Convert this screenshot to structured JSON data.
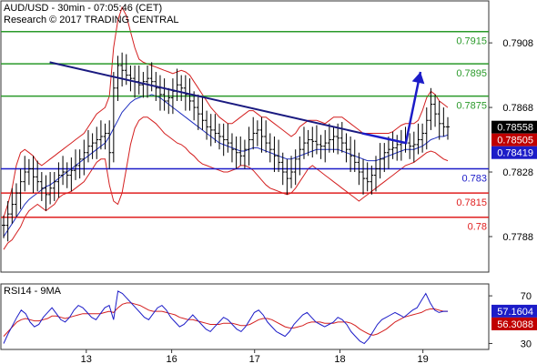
{
  "header": {
    "line1": "AUD/USD - 30min - 07:05:46 (CET)",
    "line2": "Research © 2017 TRADING CENTRAL"
  },
  "chart_data": [
    {
      "type": "candlestick",
      "title": "AUD/USD - 30min - 07:05:46 (CET)",
      "y_ticks": [
        0.7908,
        0.7868,
        0.7828,
        0.7788
      ],
      "ylim": [
        0.7766,
        0.7934
      ],
      "x_ticks": [
        "13",
        "16",
        "17",
        "18",
        "19"
      ],
      "last_price": 0.78558,
      "price_tags": [
        {
          "value": 0.78558,
          "label": "0.78558",
          "color": "#000000"
        },
        {
          "value": 0.78505,
          "label": "0.78505",
          "color": "#c00000"
        },
        {
          "value": 0.78419,
          "label": "0.78419",
          "color": "#1c1cc8"
        }
      ],
      "levels": [
        {
          "value": 0.7915,
          "label": "0.7915",
          "color": "#2a9a2a"
        },
        {
          "value": 0.7895,
          "label": "0.7895",
          "color": "#2a9a2a"
        },
        {
          "value": 0.7875,
          "label": "0.7875",
          "color": "#2a9a2a"
        },
        {
          "value": 0.783,
          "label": "0.783",
          "color": "#1c1cc8"
        },
        {
          "value": 0.7815,
          "label": "0.7815",
          "color": "#e02020"
        },
        {
          "value": 0.78,
          "label": "0.78",
          "color": "#e02020"
        }
      ],
      "price_series": [
        0.7795,
        0.7802,
        0.7808,
        0.7815,
        0.7822,
        0.7828,
        0.783,
        0.7825,
        0.7822,
        0.7818,
        0.7814,
        0.7818,
        0.7822,
        0.7826,
        0.7828,
        0.7826,
        0.7829,
        0.7832,
        0.7836,
        0.784,
        0.7844,
        0.7846,
        0.7848,
        0.785,
        0.7852,
        0.784,
        0.788,
        0.7894,
        0.7891,
        0.7888,
        0.7886,
        0.7884,
        0.7882,
        0.7884,
        0.7886,
        0.7884,
        0.788,
        0.7876,
        0.7872,
        0.7874,
        0.7878,
        0.7882,
        0.788,
        0.7876,
        0.7872,
        0.7868,
        0.7864,
        0.786,
        0.7856,
        0.7854,
        0.7852,
        0.785,
        0.7848,
        0.7846,
        0.7842,
        0.784,
        0.7838,
        0.7842,
        0.7848,
        0.7852,
        0.7854,
        0.785,
        0.7846,
        0.7842,
        0.7838,
        0.7834,
        0.7828,
        0.7824,
        0.7828,
        0.7836,
        0.7842,
        0.7846,
        0.7848,
        0.7847,
        0.7845,
        0.7844,
        0.7846,
        0.7848,
        0.785,
        0.7849,
        0.7846,
        0.7842,
        0.7838,
        0.7834,
        0.7828,
        0.7824,
        0.7822,
        0.7826,
        0.783,
        0.7836,
        0.784,
        0.7842,
        0.7843,
        0.7845,
        0.7846,
        0.7846,
        0.7844,
        0.7845,
        0.7848,
        0.7852,
        0.786,
        0.787,
        0.7864,
        0.7858,
        0.7856,
        0.7856
      ],
      "ma_series": [
        0.7788,
        0.7792,
        0.7796,
        0.78,
        0.7804,
        0.7808,
        0.7811,
        0.7813,
        0.7815,
        0.7817,
        0.7819,
        0.782,
        0.7822,
        0.7824,
        0.7826,
        0.7828,
        0.783,
        0.7832,
        0.7834,
        0.7836,
        0.7838,
        0.784,
        0.7842,
        0.7844,
        0.7846,
        0.785,
        0.7855,
        0.786,
        0.7865,
        0.7868,
        0.7871,
        0.7873,
        0.7874,
        0.7875,
        0.7875,
        0.7876,
        0.7875,
        0.7874,
        0.7872,
        0.787,
        0.7868,
        0.7866,
        0.7864,
        0.7862,
        0.786,
        0.7858,
        0.7856,
        0.7854,
        0.7852,
        0.785,
        0.7848,
        0.7846,
        0.7845,
        0.7844,
        0.7843,
        0.7842,
        0.7841,
        0.7841,
        0.7842,
        0.7843,
        0.7843,
        0.7842,
        0.7841,
        0.784,
        0.7839,
        0.7838,
        0.7837,
        0.7836,
        0.7836,
        0.7837,
        0.7838,
        0.7839,
        0.784,
        0.7841,
        0.7842,
        0.7842,
        0.7842,
        0.7842,
        0.7842,
        0.7842,
        0.7841,
        0.784,
        0.7839,
        0.7838,
        0.7837,
        0.7836,
        0.7835,
        0.7835,
        0.7835,
        0.7836,
        0.7837,
        0.7838,
        0.7839,
        0.784,
        0.7841,
        0.7842,
        0.7842,
        0.7842,
        0.7843,
        0.7844,
        0.7846,
        0.7848,
        0.7849,
        0.785,
        0.785,
        0.7851
      ],
      "upper_band": [
        0.78,
        0.7808,
        0.7818,
        0.7832,
        0.784,
        0.7842,
        0.784,
        0.7838,
        0.7834,
        0.7832,
        0.7834,
        0.7836,
        0.7838,
        0.784,
        0.7842,
        0.7844,
        0.7846,
        0.7848,
        0.785,
        0.7852,
        0.7856,
        0.786,
        0.7864,
        0.7866,
        0.7868,
        0.7875,
        0.7905,
        0.7922,
        0.793,
        0.7925,
        0.7915,
        0.7905,
        0.7898,
        0.7896,
        0.7895,
        0.7894,
        0.7893,
        0.7892,
        0.7891,
        0.789,
        0.7889,
        0.789,
        0.7891,
        0.789,
        0.7888,
        0.7884,
        0.788,
        0.7876,
        0.7872,
        0.7868,
        0.7865,
        0.7862,
        0.786,
        0.7858,
        0.7858,
        0.786,
        0.7862,
        0.7864,
        0.7866,
        0.7866,
        0.7864,
        0.7862,
        0.7862,
        0.786,
        0.7858,
        0.7856,
        0.7854,
        0.7852,
        0.785,
        0.7852,
        0.7856,
        0.7858,
        0.786,
        0.786,
        0.786,
        0.7859,
        0.7858,
        0.786,
        0.7862,
        0.7862,
        0.7862,
        0.786,
        0.7858,
        0.7856,
        0.7854,
        0.7852,
        0.7852,
        0.7852,
        0.7852,
        0.7852,
        0.7852,
        0.7852,
        0.7853,
        0.7855,
        0.7857,
        0.7858,
        0.7858,
        0.7858,
        0.786,
        0.7866,
        0.7874,
        0.7878,
        0.7876,
        0.7872,
        0.787,
        0.7868
      ],
      "lower_band": [
        0.778,
        0.7784,
        0.7786,
        0.779,
        0.7794,
        0.78,
        0.7804,
        0.7806,
        0.7808,
        0.7806,
        0.7804,
        0.7806,
        0.7808,
        0.7812,
        0.7814,
        0.7815,
        0.7816,
        0.7818,
        0.782,
        0.7822,
        0.7826,
        0.783,
        0.7834,
        0.7836,
        0.7836,
        0.782,
        0.781,
        0.7808,
        0.7815,
        0.783,
        0.7845,
        0.7855,
        0.786,
        0.7862,
        0.7862,
        0.786,
        0.7858,
        0.7855,
        0.7852,
        0.785,
        0.7848,
        0.7846,
        0.7845,
        0.7843,
        0.784,
        0.7838,
        0.7835,
        0.7833,
        0.7832,
        0.7831,
        0.783,
        0.7829,
        0.7828,
        0.7828,
        0.7829,
        0.783,
        0.7832,
        0.7832,
        0.7831,
        0.7829,
        0.7826,
        0.7823,
        0.782,
        0.7818,
        0.7817,
        0.7816,
        0.7815,
        0.7814,
        0.7815,
        0.7818,
        0.7822,
        0.7826,
        0.783,
        0.7832,
        0.783,
        0.7828,
        0.7826,
        0.7824,
        0.7822,
        0.782,
        0.7818,
        0.7816,
        0.7814,
        0.7812,
        0.781,
        0.7812,
        0.7814,
        0.7816,
        0.7818,
        0.782,
        0.7822,
        0.7824,
        0.7826,
        0.7828,
        0.783,
        0.7832,
        0.7833,
        0.7834,
        0.7836,
        0.7838,
        0.784,
        0.7841,
        0.784,
        0.7838,
        0.7836,
        0.7835
      ],
      "trendline": {
        "from": [
          0.1,
          0.7896
        ],
        "to": [
          0.74,
          0.7852
        ]
      },
      "projection": [
        [
          0.74,
          0.7852
        ],
        [
          0.83,
          0.7846
        ],
        [
          0.86,
          0.789
        ]
      ]
    },
    {
      "type": "line",
      "title": "RSI14 - 9MA",
      "y_ticks": [
        70,
        30
      ],
      "ylim": [
        25,
        80
      ],
      "values": {
        "RSI14": 57.1604,
        "9MA": 56.3088
      },
      "labels": {
        "RSI14": "57.1604",
        "9MA": "56.3088"
      },
      "rsi_series": [
        30,
        38,
        45,
        52,
        58,
        55,
        48,
        44,
        46,
        52,
        56,
        60,
        55,
        50,
        48,
        52,
        58,
        62,
        60,
        56,
        52,
        50,
        55,
        60,
        62,
        50,
        74,
        72,
        68,
        64,
        60,
        56,
        52,
        50,
        55,
        60,
        62,
        58,
        52,
        48,
        44,
        46,
        50,
        54,
        50,
        46,
        42,
        40,
        44,
        48,
        52,
        50,
        46,
        42,
        40,
        44,
        50,
        56,
        58,
        54,
        48,
        44,
        40,
        38,
        36,
        40,
        46,
        50,
        54,
        56,
        52,
        48,
        46,
        44,
        46,
        48,
        52,
        50,
        46,
        40,
        36,
        32,
        30,
        34,
        40,
        46,
        50,
        52,
        54,
        56,
        54,
        52,
        55,
        58,
        60,
        66,
        72,
        64,
        58,
        56,
        57,
        57
      ],
      "ma_series": [
        36,
        40,
        44,
        48,
        50,
        51,
        50,
        49,
        49,
        50,
        51,
        53,
        53,
        52,
        51,
        52,
        53,
        54,
        55,
        55,
        55,
        55,
        55,
        56,
        57,
        56,
        60,
        63,
        64,
        64,
        63,
        62,
        60,
        58,
        57,
        57,
        57,
        56,
        55,
        54,
        52,
        51,
        50,
        50,
        49,
        48,
        47,
        46,
        46,
        46,
        47,
        47,
        47,
        46,
        45,
        45,
        46,
        48,
        50,
        51,
        51,
        50,
        48,
        46,
        44,
        43,
        43,
        44,
        45,
        47,
        48,
        48,
        48,
        47,
        47,
        47,
        48,
        48,
        48,
        47,
        45,
        42,
        40,
        38,
        37,
        38,
        40,
        42,
        45,
        48,
        50,
        52,
        53,
        54,
        55,
        56,
        58,
        59,
        59,
        58,
        57,
        57
      ]
    }
  ]
}
